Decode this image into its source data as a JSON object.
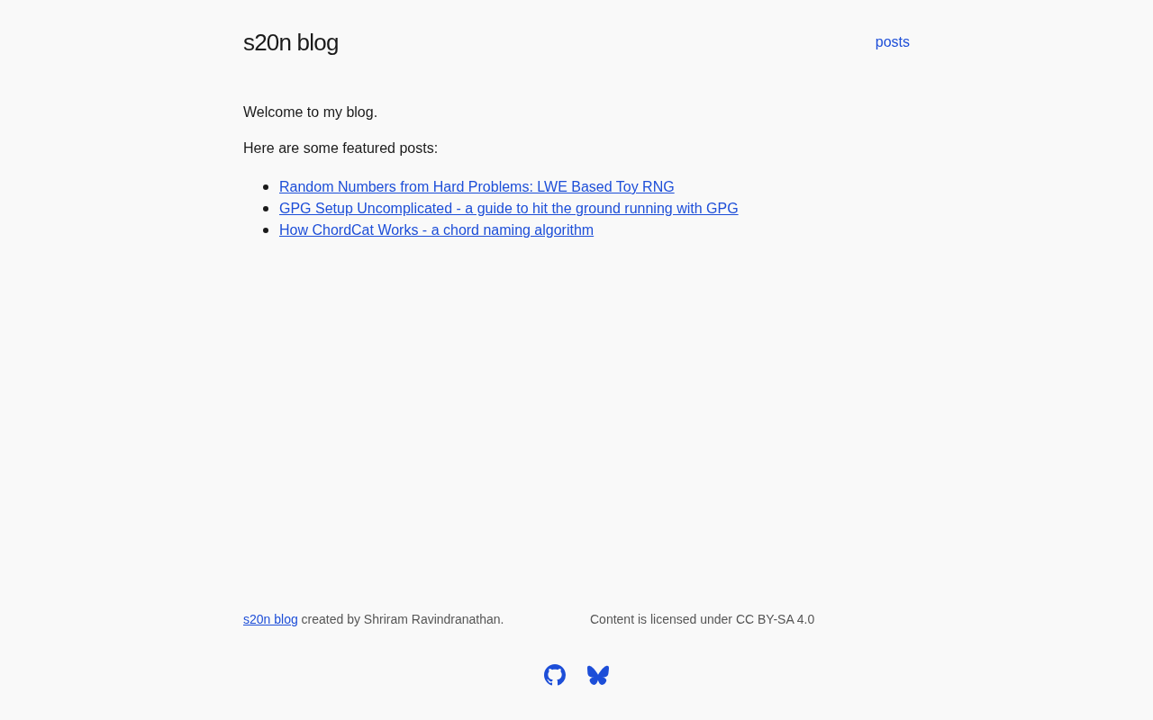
{
  "header": {
    "title": "s20n blog",
    "nav": [
      {
        "label": "posts"
      }
    ]
  },
  "intro": "Welcome to my blog.",
  "featured_heading": "Here are some featured posts:",
  "featured_posts": [
    {
      "title": "Random Numbers from Hard Problems: LWE Based Toy RNG"
    },
    {
      "title": "GPG Setup Uncomplicated - a guide to hit the ground running with GPG"
    },
    {
      "title": "How ChordCat Works - a chord naming algorithm"
    }
  ],
  "footer": {
    "site_link": "s20n blog",
    "credit": "created by Shriram Ravindranathan.",
    "license": "Content is licensed under CC BY-SA 4.0",
    "social": [
      {
        "kind": "github"
      },
      {
        "kind": "bluesky"
      }
    ]
  }
}
